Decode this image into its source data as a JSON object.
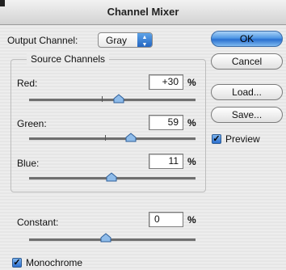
{
  "dialog": {
    "title": "Channel Mixer"
  },
  "output": {
    "label": "Output Channel:",
    "value": "Gray"
  },
  "source": {
    "title": "Source Channels",
    "red": {
      "label": "Red:",
      "value": "+30",
      "unit": "%",
      "slider_fraction": 0.6
    },
    "green": {
      "label": "Green:",
      "value": "59",
      "unit": "%",
      "slider_fraction": 0.7
    },
    "blue": {
      "label": "Blue:",
      "value": "11",
      "unit": "%",
      "slider_fraction": 0.55
    }
  },
  "constant": {
    "label": "Constant:",
    "value": "0",
    "unit": "%",
    "slider_fraction": 0.5
  },
  "monochrome": {
    "label": "Monochrome",
    "checked": true
  },
  "buttons": {
    "ok": "OK",
    "cancel": "Cancel",
    "load": "Load...",
    "save": "Save..."
  },
  "preview": {
    "label": "Preview",
    "checked": true
  },
  "colors": {
    "accent": "#3a7fd8"
  }
}
